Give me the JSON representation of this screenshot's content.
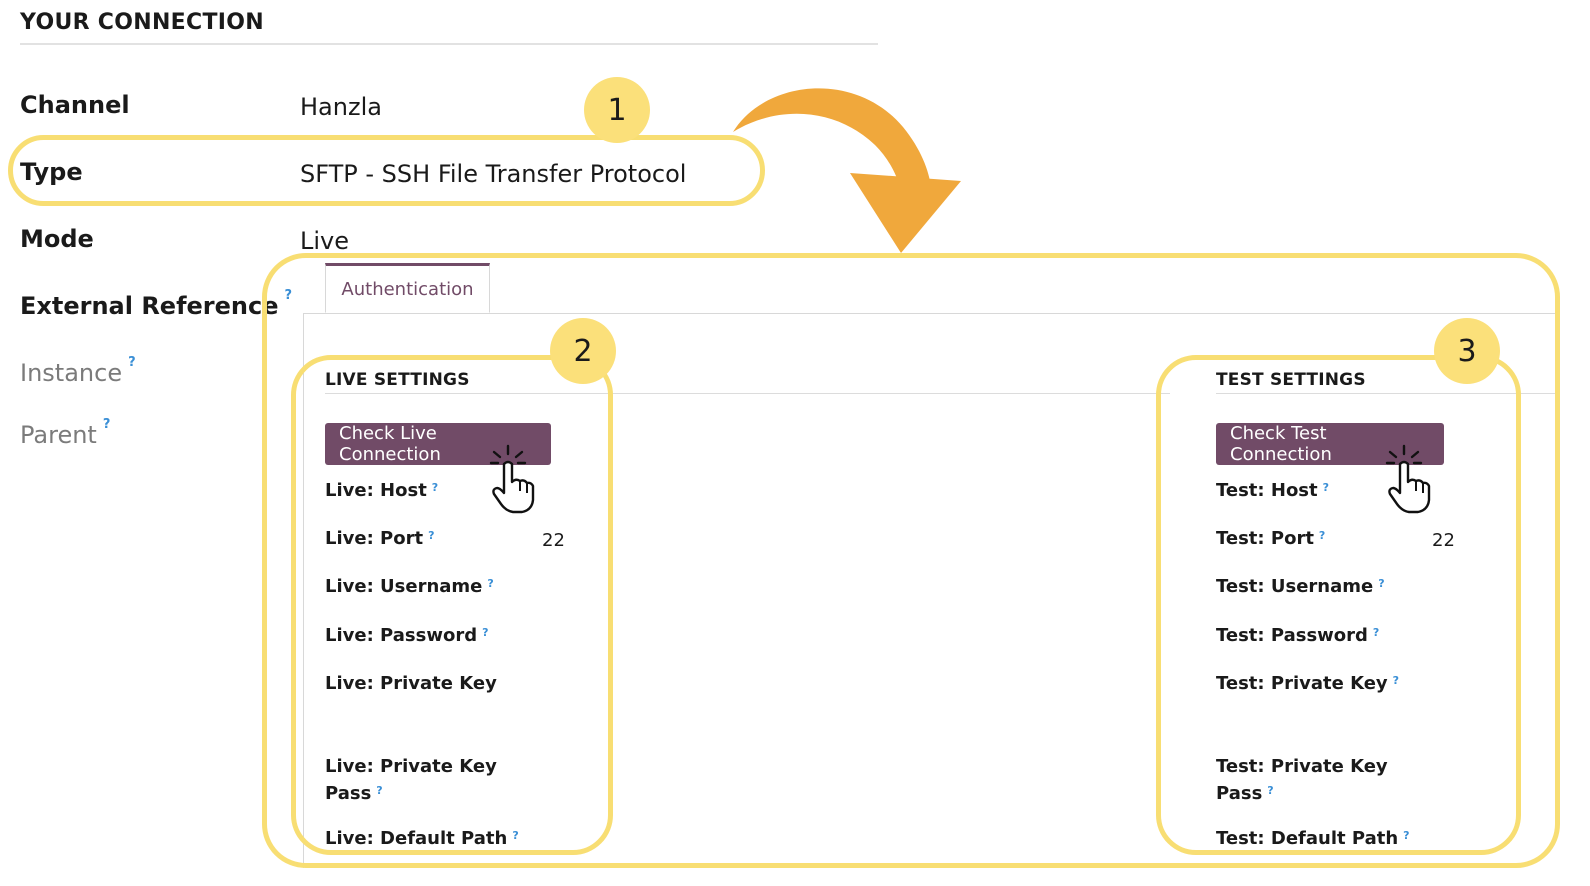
{
  "section": {
    "title": "YOUR CONNECTION"
  },
  "fields": {
    "channel": {
      "label": "Channel",
      "value": "Hanzla"
    },
    "type": {
      "label": "Type",
      "value": "SFTP - SSH File Transfer Protocol"
    },
    "mode": {
      "label": "Mode",
      "value": "Live"
    },
    "external_reference": {
      "label": "External Reference"
    },
    "instance": {
      "label": "Instance"
    },
    "parent": {
      "label": "Parent"
    }
  },
  "help_mark": "?",
  "tabs": [
    {
      "label": "Authentication"
    }
  ],
  "live": {
    "title": "LIVE SETTINGS",
    "button": "Check Live Connection",
    "host": "Live: Host",
    "port": "Live: Port",
    "port_value": "22",
    "username": "Live: Username",
    "password": "Live: Password",
    "private_key": "Live: Private Key",
    "private_key_pass_1": "Live: Private Key",
    "private_key_pass_2": "Pass",
    "default_path": "Live: Default Path"
  },
  "test": {
    "title": "TEST SETTINGS",
    "button": "Check Test Connection",
    "host": "Test: Host",
    "port": "Test: Port",
    "port_value": "22",
    "username": "Test: Username",
    "password": "Test: Password",
    "private_key": "Test: Private Key",
    "private_key_pass_1": "Test: Private Key",
    "private_key_pass_2": "Pass",
    "default_path": "Test: Default Path"
  },
  "annotations": {
    "badge1": "1",
    "badge2": "2",
    "badge3": "3"
  },
  "colors": {
    "primary": "#714b67",
    "highlight": "#f8de73",
    "badge": "#fbe07a",
    "arrow": "#f0a83c",
    "help": "#3a8fd6"
  }
}
